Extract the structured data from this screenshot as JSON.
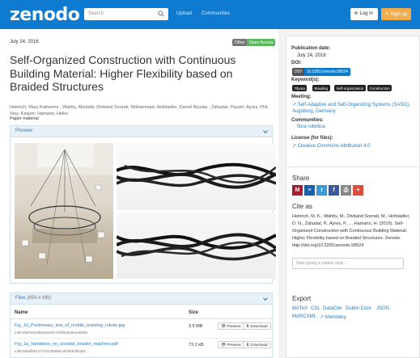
{
  "navbar": {
    "logo": "zenodo",
    "search_placeholder": "Search",
    "links": [
      "Upload",
      "Communities"
    ],
    "login": "Log in",
    "signup": "Sign up",
    "color": "#0f7bd0"
  },
  "record": {
    "date": "July 24, 2016",
    "badges": [
      "Other",
      "Open Access"
    ],
    "title": "Self-Organized Construction with Continuous Building Material: Higher Flexibility based on Braided Structures",
    "authors": "Heinrich, Mary Katherine ; Wahby, Mostafa; Divband Soorati, Mohammad; Hofstadler, Daniel Nicolas ; Zahadat, Payam; Ayres, Phil; Stoy, Kasper; Hamann, Heiko",
    "resource_type": "Paper material"
  },
  "preview": {
    "title": "Preview"
  },
  "files": {
    "title": "Files",
    "size_total": "(659.4 MB)",
    "headers": {
      "name": "Name",
      "size": "Size"
    },
    "rows": [
      {
        "name": "Fig_10_Preliminary_test_of_mobile_braiding_robots.jpg",
        "md5": "md5:88d7e0ed60e63e62733ff4eb4ae4a6509",
        "size": "3.5 MB",
        "preview": "Preview",
        "download": "Download"
      },
      {
        "name": "Fig_1a_Variations_on_sisoidal_braider_machine.pdf",
        "md5": "md5:58ddf5812770113b996ca00d0d3ff4d61",
        "size": "73.1 kB",
        "preview": "Preview",
        "download": "Download"
      }
    ]
  },
  "sidebar": {
    "pub_date_label": "Publication date:",
    "pub_date": "July 24, 2016",
    "doi_label": "DOI:",
    "doi_prefix": "DOI",
    "doi": "10.5281/zenodo.58524",
    "keywords_label": "Keyword(s):",
    "keywords": [
      "Tilputa",
      "Braiding",
      "Self-organization",
      "Construction"
    ],
    "meeting_label": "Meeting:",
    "meeting": "Self-Adaptive and Self-Organizing Systems (SASO), Augsburg, Germany",
    "communities_label": "Communities:",
    "community": "flora robotica",
    "license_label": "License (for files):",
    "license": "Creative Commons Attribution 4.0",
    "share_label": "Share",
    "share_icons": [
      "mendeley-icon",
      "reddit-icon",
      "twitter-icon",
      "facebook-icon",
      "print-icon",
      "google-plus-icon"
    ],
    "cite_label": "Cite as",
    "citation": "Heinrich, M. K., Wahby, M., Divband Soorati, M., Hofstadler, D. N., Zahadat, P., Ayres, P., ... Hamann, H. (2016). Self-Organized Construction with Continuous Building Material: Higher Flexibility based on Braided Structures. Zenodo. http://doi.org/10.5281/zenodo.58524",
    "cite_placeholder": "Start typing a citation style...",
    "export_label": "Export",
    "export_links": [
      "BibTeX",
      "CSL",
      "DataCite",
      "Dublin Core",
      "JSON",
      "MARCXML",
      "Mendeley"
    ]
  }
}
